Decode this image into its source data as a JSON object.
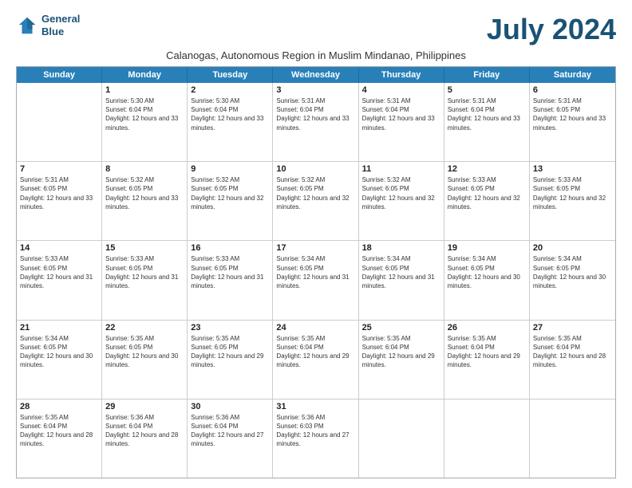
{
  "header": {
    "logo_line1": "General",
    "logo_line2": "Blue",
    "month_title": "July 2024",
    "subtitle": "Calanogas, Autonomous Region in Muslim Mindanao, Philippines"
  },
  "weekdays": [
    "Sunday",
    "Monday",
    "Tuesday",
    "Wednesday",
    "Thursday",
    "Friday",
    "Saturday"
  ],
  "weeks": [
    [
      {
        "day": "",
        "sunrise": "",
        "sunset": "",
        "daylight": ""
      },
      {
        "day": "1",
        "sunrise": "Sunrise: 5:30 AM",
        "sunset": "Sunset: 6:04 PM",
        "daylight": "Daylight: 12 hours and 33 minutes."
      },
      {
        "day": "2",
        "sunrise": "Sunrise: 5:30 AM",
        "sunset": "Sunset: 6:04 PM",
        "daylight": "Daylight: 12 hours and 33 minutes."
      },
      {
        "day": "3",
        "sunrise": "Sunrise: 5:31 AM",
        "sunset": "Sunset: 6:04 PM",
        "daylight": "Daylight: 12 hours and 33 minutes."
      },
      {
        "day": "4",
        "sunrise": "Sunrise: 5:31 AM",
        "sunset": "Sunset: 6:04 PM",
        "daylight": "Daylight: 12 hours and 33 minutes."
      },
      {
        "day": "5",
        "sunrise": "Sunrise: 5:31 AM",
        "sunset": "Sunset: 6:04 PM",
        "daylight": "Daylight: 12 hours and 33 minutes."
      },
      {
        "day": "6",
        "sunrise": "Sunrise: 5:31 AM",
        "sunset": "Sunset: 6:05 PM",
        "daylight": "Daylight: 12 hours and 33 minutes."
      }
    ],
    [
      {
        "day": "7",
        "sunrise": "Sunrise: 5:31 AM",
        "sunset": "Sunset: 6:05 PM",
        "daylight": "Daylight: 12 hours and 33 minutes."
      },
      {
        "day": "8",
        "sunrise": "Sunrise: 5:32 AM",
        "sunset": "Sunset: 6:05 PM",
        "daylight": "Daylight: 12 hours and 33 minutes."
      },
      {
        "day": "9",
        "sunrise": "Sunrise: 5:32 AM",
        "sunset": "Sunset: 6:05 PM",
        "daylight": "Daylight: 12 hours and 32 minutes."
      },
      {
        "day": "10",
        "sunrise": "Sunrise: 5:32 AM",
        "sunset": "Sunset: 6:05 PM",
        "daylight": "Daylight: 12 hours and 32 minutes."
      },
      {
        "day": "11",
        "sunrise": "Sunrise: 5:32 AM",
        "sunset": "Sunset: 6:05 PM",
        "daylight": "Daylight: 12 hours and 32 minutes."
      },
      {
        "day": "12",
        "sunrise": "Sunrise: 5:33 AM",
        "sunset": "Sunset: 6:05 PM",
        "daylight": "Daylight: 12 hours and 32 minutes."
      },
      {
        "day": "13",
        "sunrise": "Sunrise: 5:33 AM",
        "sunset": "Sunset: 6:05 PM",
        "daylight": "Daylight: 12 hours and 32 minutes."
      }
    ],
    [
      {
        "day": "14",
        "sunrise": "Sunrise: 5:33 AM",
        "sunset": "Sunset: 6:05 PM",
        "daylight": "Daylight: 12 hours and 31 minutes."
      },
      {
        "day": "15",
        "sunrise": "Sunrise: 5:33 AM",
        "sunset": "Sunset: 6:05 PM",
        "daylight": "Daylight: 12 hours and 31 minutes."
      },
      {
        "day": "16",
        "sunrise": "Sunrise: 5:33 AM",
        "sunset": "Sunset: 6:05 PM",
        "daylight": "Daylight: 12 hours and 31 minutes."
      },
      {
        "day": "17",
        "sunrise": "Sunrise: 5:34 AM",
        "sunset": "Sunset: 6:05 PM",
        "daylight": "Daylight: 12 hours and 31 minutes."
      },
      {
        "day": "18",
        "sunrise": "Sunrise: 5:34 AM",
        "sunset": "Sunset: 6:05 PM",
        "daylight": "Daylight: 12 hours and 31 minutes."
      },
      {
        "day": "19",
        "sunrise": "Sunrise: 5:34 AM",
        "sunset": "Sunset: 6:05 PM",
        "daylight": "Daylight: 12 hours and 30 minutes."
      },
      {
        "day": "20",
        "sunrise": "Sunrise: 5:34 AM",
        "sunset": "Sunset: 6:05 PM",
        "daylight": "Daylight: 12 hours and 30 minutes."
      }
    ],
    [
      {
        "day": "21",
        "sunrise": "Sunrise: 5:34 AM",
        "sunset": "Sunset: 6:05 PM",
        "daylight": "Daylight: 12 hours and 30 minutes."
      },
      {
        "day": "22",
        "sunrise": "Sunrise: 5:35 AM",
        "sunset": "Sunset: 6:05 PM",
        "daylight": "Daylight: 12 hours and 30 minutes."
      },
      {
        "day": "23",
        "sunrise": "Sunrise: 5:35 AM",
        "sunset": "Sunset: 6:05 PM",
        "daylight": "Daylight: 12 hours and 29 minutes."
      },
      {
        "day": "24",
        "sunrise": "Sunrise: 5:35 AM",
        "sunset": "Sunset: 6:04 PM",
        "daylight": "Daylight: 12 hours and 29 minutes."
      },
      {
        "day": "25",
        "sunrise": "Sunrise: 5:35 AM",
        "sunset": "Sunset: 6:04 PM",
        "daylight": "Daylight: 12 hours and 29 minutes."
      },
      {
        "day": "26",
        "sunrise": "Sunrise: 5:35 AM",
        "sunset": "Sunset: 6:04 PM",
        "daylight": "Daylight: 12 hours and 29 minutes."
      },
      {
        "day": "27",
        "sunrise": "Sunrise: 5:35 AM",
        "sunset": "Sunset: 6:04 PM",
        "daylight": "Daylight: 12 hours and 28 minutes."
      }
    ],
    [
      {
        "day": "28",
        "sunrise": "Sunrise: 5:35 AM",
        "sunset": "Sunset: 6:04 PM",
        "daylight": "Daylight: 12 hours and 28 minutes."
      },
      {
        "day": "29",
        "sunrise": "Sunrise: 5:36 AM",
        "sunset": "Sunset: 6:04 PM",
        "daylight": "Daylight: 12 hours and 28 minutes."
      },
      {
        "day": "30",
        "sunrise": "Sunrise: 5:36 AM",
        "sunset": "Sunset: 6:04 PM",
        "daylight": "Daylight: 12 hours and 27 minutes."
      },
      {
        "day": "31",
        "sunrise": "Sunrise: 5:36 AM",
        "sunset": "Sunset: 6:03 PM",
        "daylight": "Daylight: 12 hours and 27 minutes."
      },
      {
        "day": "",
        "sunrise": "",
        "sunset": "",
        "daylight": ""
      },
      {
        "day": "",
        "sunrise": "",
        "sunset": "",
        "daylight": ""
      },
      {
        "day": "",
        "sunrise": "",
        "sunset": "",
        "daylight": ""
      }
    ]
  ]
}
